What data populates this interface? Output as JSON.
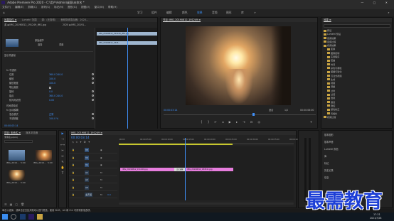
{
  "titlebar": {
    "title": "Adobe Premiere Pro 2020 - C:\\用户\\Admin\\桌面\\未命名 *"
  },
  "menubar": {
    "items": [
      "文件(F)",
      "编辑(E)",
      "剪辑(C)",
      "序列(S)",
      "标记(M)",
      "图形(G)",
      "视图(V)",
      "窗口(W)",
      "帮助(H)"
    ]
  },
  "workspace_tabs": [
    "学习",
    "组件",
    "编辑",
    "颜色",
    "效果",
    "音频",
    "图形",
    "库"
  ],
  "effect_controls": {
    "tabs": [
      "效果控件 ≡",
      "Lumetri 范围",
      "源：(无剪辑)",
      "音频剪辑混合器：2020..."
    ],
    "source_label": "源 ▪ IMG_20190812_191249_IMG.jpg",
    "seq_label": "2020 ▪ IMG_20191...",
    "clip_name": "IMG_20190812_191249_IMG.jpg",
    "clip_name2": "IMG_20190812_1845...",
    "thumb_label1": "原始细节",
    "thumb_label2": "重置",
    "thumb_label3": "选择",
    "sections": [
      {
        "label": "显示关键帧",
        "value": ""
      },
      {
        "label": "fx 不透明",
        "value": ""
      },
      {
        "label": "位置",
        "value": "360.0  240.0"
      },
      {
        "label": "缩放",
        "value": "100.0"
      },
      {
        "label": "缩放宽度",
        "value": "100.0"
      },
      {
        "label": "等比缩放",
        "value": ""
      },
      {
        "label": "旋转",
        "value": "0.0"
      },
      {
        "label": "锚点",
        "value": "360.0  240.0"
      },
      {
        "label": "防闪烁滤镜",
        "value": "0.00"
      },
      {
        "label": "时间重映射",
        "value": ""
      },
      {
        "label": "fx 运动模糊",
        "value": ""
      },
      {
        "label": "混合模式",
        "value": "正常"
      },
      {
        "label": "不透明度",
        "value": "100.0 %"
      }
    ],
    "timecode": "00:00:03:14"
  },
  "program": {
    "tab": "节目: IMG_20190812_191249 ≡",
    "timecode_left": "00:00:03:14",
    "fit": "适合",
    "quality": "1/2",
    "timecode_right": "00:00:06:00"
  },
  "effects_panel": {
    "tab": "效果 ≡",
    "items": [
      "预设",
      "Lumetri 预设",
      "音频效果",
      "音频过渡",
      "视频效果",
      "变换",
      "图像控制",
      "实用程序",
      "扭曲",
      "时间",
      "杂色与颗粒",
      "模糊与锐化",
      "沉浸式视频",
      "生成",
      "视频",
      "调整",
      "过时",
      "过渡",
      "透视",
      "通道",
      "键控",
      "颜色校正",
      "风格化",
      "视频过渡"
    ],
    "bottom": [
      "基本图形",
      "基本声音",
      "Lumetri 颜色",
      "库",
      "标记",
      "历史记录",
      "信息"
    ]
  },
  "project": {
    "tabs": [
      "项目: 未命名 ≡",
      "媒体浏览器"
    ],
    "name": "未命名.prproj",
    "items": [
      {
        "name": "IMG_2019...",
        "dur": "5:00"
      },
      {
        "name": "IMG_2019...",
        "dur": "5:00"
      },
      {
        "name": "IMG_2019...",
        "dur": "5:00"
      }
    ]
  },
  "timeline": {
    "tab": "IMG_20190812_191249 ≡",
    "timecode": "00:00:03:14",
    "ruler": [
      ":00:00",
      "00:00:05:00",
      "00:00:10:00",
      "00:00:15:00",
      "00:00:20:00",
      "00:00:25:00",
      "00:00:30:00",
      "00:00:35:00",
      "00:00:40:00"
    ],
    "tracks": [
      "V3",
      "V2",
      "V1",
      "A1",
      "A2",
      "A3",
      "主声道"
    ],
    "clip1": "IMG_20190812_191249.jpg",
    "clip2": "交叉溶解",
    "clip3": "IMG_20190812_184511.jpg",
    "master_value": "0.0"
  },
  "statusbar": {
    "text": "单击以选择，或单击空白处并拖动以进行框选。使用 Shift、Alt 和 Ctrl 可获得其他选项。"
  },
  "taskbar": {
    "time": "17:21",
    "date": "2021/7/28"
  },
  "watermark": {
    "text": "最需教育"
  },
  "colors": {
    "accent": "#3f8ff7",
    "clip": "#e67ddd",
    "bg": "#1d1d1d"
  }
}
